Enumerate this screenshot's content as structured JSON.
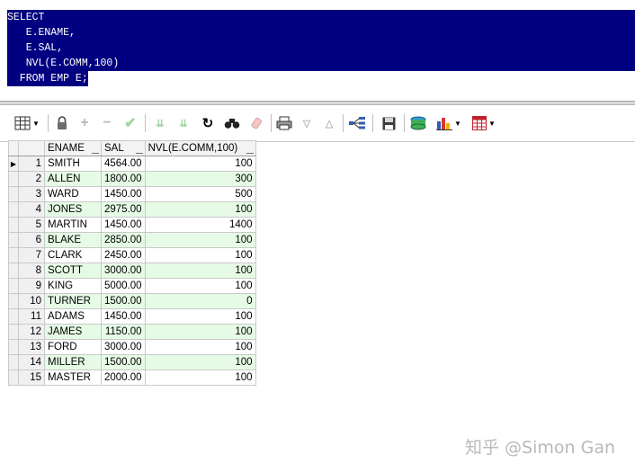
{
  "editor": {
    "sql_lines": [
      "SELECT",
      "   E.ENAME,",
      "   E.SAL,",
      "   NVL(E.COMM,100)",
      "  FROM EMP E;"
    ]
  },
  "toolbar": {
    "icons": [
      "grid-view-icon",
      "lock-icon",
      "add-record-icon",
      "delete-record-icon",
      "post-changes-icon",
      "fetch-next-icon",
      "fetch-last-icon",
      "refresh-icon",
      "find-icon",
      "clear-icon",
      "print-icon",
      "sort-down-icon",
      "sort-up-icon",
      "query-by-example-icon",
      "save-icon",
      "export-icon",
      "chart-icon",
      "table-options-icon"
    ]
  },
  "grid": {
    "columns": [
      "ENAME",
      "SAL",
      "NVL(E.COMM,100)"
    ],
    "rows": [
      {
        "n": "1",
        "ename": "SMITH",
        "sal": "4564.00",
        "nvl": "100"
      },
      {
        "n": "2",
        "ename": "ALLEN",
        "sal": "1800.00",
        "nvl": "300"
      },
      {
        "n": "3",
        "ename": "WARD",
        "sal": "1450.00",
        "nvl": "500"
      },
      {
        "n": "4",
        "ename": "JONES",
        "sal": "2975.00",
        "nvl": "100"
      },
      {
        "n": "5",
        "ename": "MARTIN",
        "sal": "1450.00",
        "nvl": "1400"
      },
      {
        "n": "6",
        "ename": "BLAKE",
        "sal": "2850.00",
        "nvl": "100"
      },
      {
        "n": "7",
        "ename": "CLARK",
        "sal": "2450.00",
        "nvl": "100"
      },
      {
        "n": "8",
        "ename": "SCOTT",
        "sal": "3000.00",
        "nvl": "100"
      },
      {
        "n": "9",
        "ename": "KING",
        "sal": "5000.00",
        "nvl": "100"
      },
      {
        "n": "10",
        "ename": "TURNER",
        "sal": "1500.00",
        "nvl": "0"
      },
      {
        "n": "11",
        "ename": "ADAMS",
        "sal": "1450.00",
        "nvl": "100"
      },
      {
        "n": "12",
        "ename": "JAMES",
        "sal": "1150.00",
        "nvl": "100"
      },
      {
        "n": "13",
        "ename": "FORD",
        "sal": "3000.00",
        "nvl": "100"
      },
      {
        "n": "14",
        "ename": "MILLER",
        "sal": "1500.00",
        "nvl": "100"
      },
      {
        "n": "15",
        "ename": "MASTER",
        "sal": "2000.00",
        "nvl": "100"
      }
    ]
  },
  "watermark": "知乎 @Simon Gan"
}
